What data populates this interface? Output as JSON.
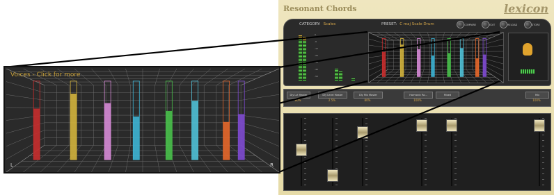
{
  "plugin": {
    "title": "Resonant Chords",
    "brand": "lexicon",
    "category_label": "CATEGORY:",
    "category_value": "Scales",
    "preset_label": "PRESET:",
    "preset_value": "C maj Scale Drum",
    "buttons": [
      "COMPARE",
      "EDIT",
      "RELOAD",
      "STORE"
    ]
  },
  "params": {
    "items": [
      {
        "label": "Dly Lvl Master",
        "value": "80%"
      },
      {
        "label": "Dly Level Master",
        "value": "2.5%"
      },
      {
        "label": "Dly Mix Master",
        "value": "80%"
      },
      {
        "label": "Harmonic Ro...",
        "value": "100%"
      },
      {
        "label": "Mixed",
        "value": "..."
      },
      {
        "label": "Mix",
        "value": "100%"
      }
    ]
  },
  "meters": {
    "scale": [
      "0",
      "-6",
      "-12",
      "-20",
      "-30",
      "-40",
      "-50"
    ]
  },
  "zoom": {
    "voices_label": "Voices - Click for more",
    "left_channel": "L",
    "right_channel": "R",
    "voices": [
      {
        "color": "#c72e2e",
        "level": 0.65
      },
      {
        "color": "#d2b23c",
        "level": 0.84
      },
      {
        "color": "#d68ad6",
        "level": 0.72
      },
      {
        "color": "#3db4d4",
        "level": 0.55
      },
      {
        "color": "#48c04a",
        "level": 0.62
      },
      {
        "color": "#4fc0d6",
        "level": 0.75
      },
      {
        "color": "#e5672a",
        "level": 0.48
      },
      {
        "color": "#7e4ad0",
        "level": 0.58
      }
    ]
  },
  "faders": {
    "levels": [
      0.55,
      0.1,
      0.85,
      0.98,
      0.98,
      0.98
    ]
  }
}
